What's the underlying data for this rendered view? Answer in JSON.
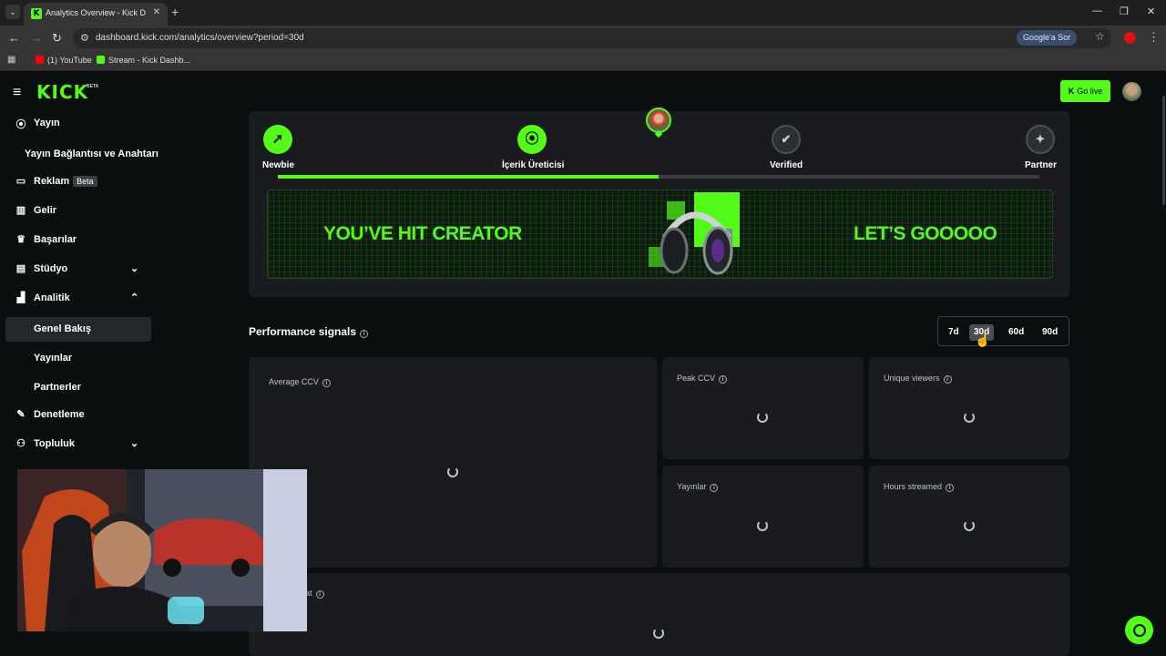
{
  "browser": {
    "tab_title": "Analytics Overview - Kick Dashb",
    "url": "dashboard.kick.com/analytics/overview?period=30d",
    "google_ask": "Google'a Sor",
    "bookmarks": [
      {
        "label": "(1) YouTube",
        "color": "#ff0000"
      },
      {
        "label": "Stream - Kick Dashb...",
        "color": "#53fc18"
      }
    ]
  },
  "header": {
    "logo": "KICK",
    "logo_badge": "BETA",
    "go_live": "Go live",
    "accent_color": "#53fc18"
  },
  "sidebar": {
    "items": [
      {
        "label": "Yayın",
        "icon": "broadcast-icon"
      },
      {
        "label": "Yayın Bağlantısı ve Anahtarı",
        "icon": ""
      },
      {
        "label": "Reklam",
        "icon": "ad-icon",
        "badge": "Beta"
      },
      {
        "label": "Gelir",
        "icon": "revenue-icon"
      },
      {
        "label": "Başarılar",
        "icon": "trophy-icon"
      },
      {
        "label": "Stüdyo",
        "icon": "studio-icon",
        "expandable": true
      },
      {
        "label": "Analitik",
        "icon": "analytics-icon",
        "expanded": true
      },
      {
        "label": "Genel Bakış",
        "sub": true,
        "active": true
      },
      {
        "label": "Yayınlar",
        "sub": true
      },
      {
        "label": "Partnerler",
        "sub": true
      },
      {
        "label": "Denetleme",
        "icon": "wrench-icon"
      },
      {
        "label": "Topluluk",
        "icon": "community-icon",
        "expandable": true
      }
    ]
  },
  "progress": {
    "steps": [
      {
        "label": "Newbie",
        "status": "done"
      },
      {
        "label": "İçerik Üreticisi",
        "status": "done"
      },
      {
        "label": "Verified",
        "status": "todo"
      },
      {
        "label": "Partner",
        "status": "todo"
      }
    ],
    "progress_fraction": 0.5,
    "banner": {
      "left_text": "YOU’VE HIT CREATOR",
      "right_text": "LET’S GOOOOO"
    }
  },
  "performance": {
    "title": "Performance signals",
    "periods": [
      "7d",
      "30d",
      "60d",
      "90d"
    ],
    "selected_period": "30d",
    "panels": [
      {
        "key": "average_ccv",
        "title": "Average CCV",
        "loading": true
      },
      {
        "key": "peak_ccv",
        "title": "Peak CCV",
        "loading": true
      },
      {
        "key": "unique_viewers",
        "title": "Unique viewers",
        "loading": true
      },
      {
        "key": "streams",
        "title": "Yayınlar",
        "loading": true
      },
      {
        "key": "hours_streamed",
        "title": "Hours streamed",
        "loading": true
      },
      {
        "key": "bottom_panel",
        "title": "at",
        "loading": true
      }
    ]
  }
}
